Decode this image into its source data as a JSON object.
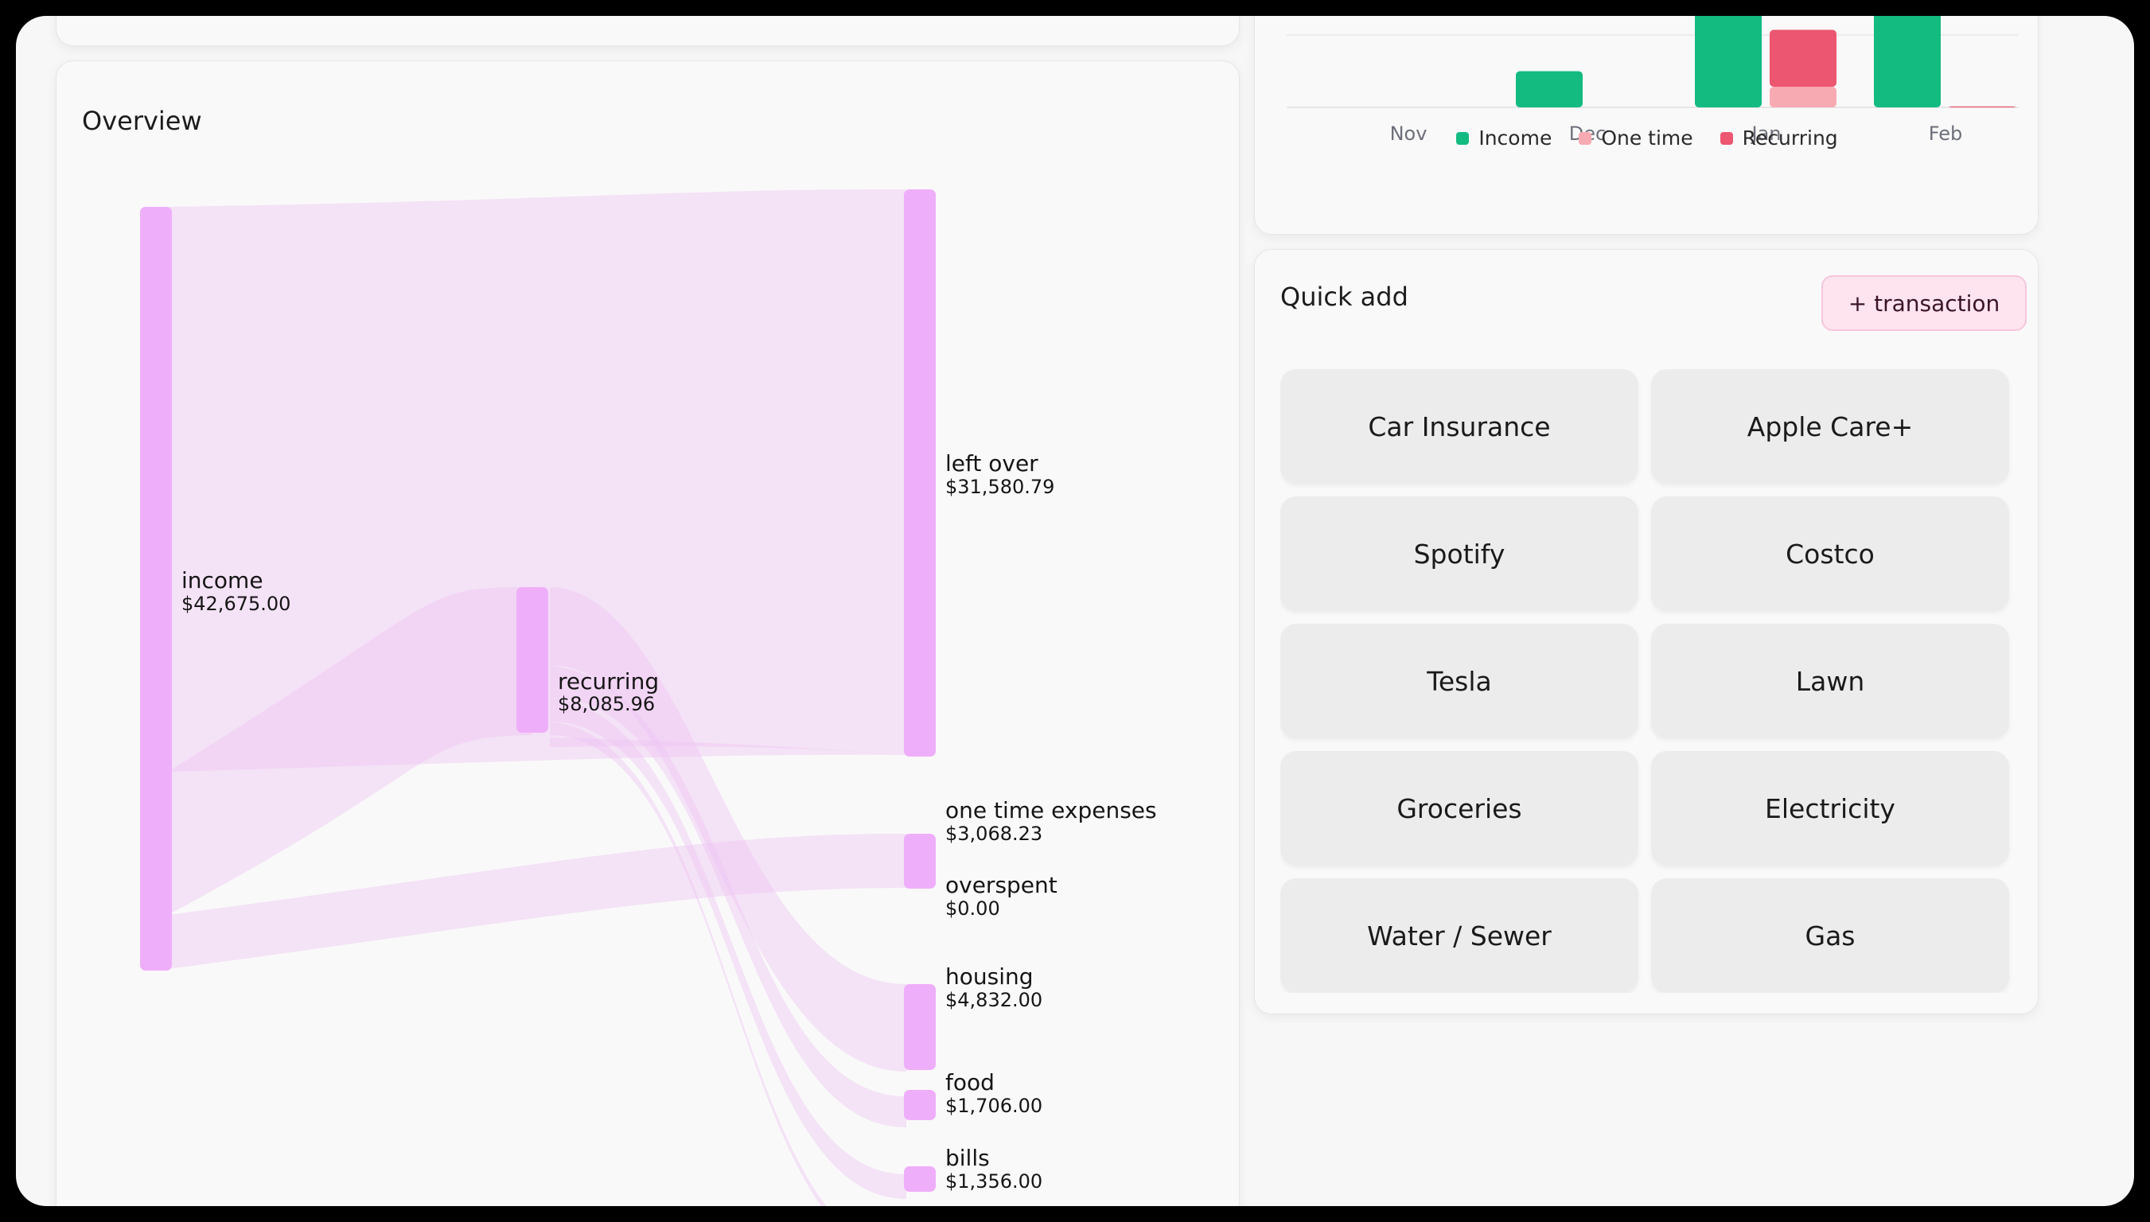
{
  "overview": {
    "title": "Overview",
    "nodes": {
      "income": {
        "label": "income",
        "value": "$42,675.00"
      },
      "recurring": {
        "label": "recurring",
        "value": "$8,085.96"
      },
      "left_over": {
        "label": "left over",
        "value": "$31,580.79"
      },
      "one_time": {
        "label": "one time expenses",
        "value": "$3,068.23"
      },
      "overspent": {
        "label": "overspent",
        "value": "$0.00"
      },
      "housing": {
        "label": "housing",
        "value": "$4,832.00"
      },
      "food": {
        "label": "food",
        "value": "$1,706.00"
      },
      "bills": {
        "label": "bills",
        "value": "$1,356.00"
      }
    },
    "node_color": "#efaefa",
    "link_color": "#eec3f3"
  },
  "monthly_chart": {
    "colors": {
      "income": "#13bb80",
      "one_time": "#f8aab3",
      "recurring": "#ec5670"
    },
    "legend": {
      "income": "Income",
      "one_time": "One time",
      "recurring": "Recurring"
    }
  },
  "chart_data": {
    "type": "bar",
    "categories": [
      "Nov",
      "Dec",
      "Jan",
      "Feb"
    ],
    "series": [
      {
        "name": "Income",
        "values": [
          0,
          0.35,
          1.0,
          1.0
        ]
      },
      {
        "name": "One time",
        "values": [
          0,
          0,
          0.2,
          0
        ]
      },
      {
        "name": "Recurring",
        "values": [
          0,
          0,
          0.55,
          0.01
        ]
      }
    ],
    "stacked_series": [
      "One time",
      "Recurring"
    ],
    "legend": "bottom",
    "grid": true
  },
  "quick_add": {
    "title": "Quick add",
    "add_button": "+ transaction",
    "items": [
      "Car Insurance",
      "Apple Care+",
      "Spotify",
      "Costco",
      "Tesla",
      "Lawn",
      "Groceries",
      "Electricity",
      "Water / Sewer",
      "Gas"
    ]
  }
}
